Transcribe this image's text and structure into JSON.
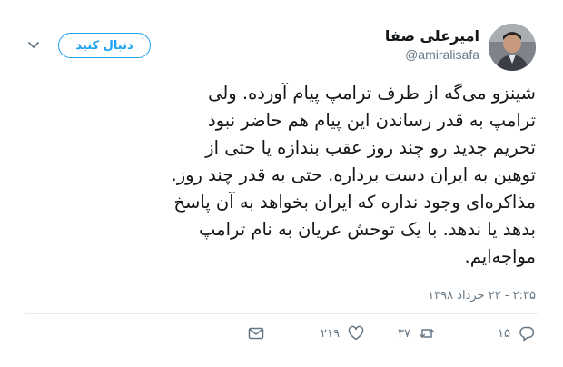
{
  "user": {
    "display_name": "امیرعلی صفا",
    "handle": "@amiralisafa"
  },
  "follow_button": {
    "label": "دنبال کنید"
  },
  "tweet": {
    "lines": [
      "شینزو می‌گه از طرف ترامپ پیام آورده. ولی",
      "ترامپ به قدر رساندن این پیام هم حاضر نبود",
      "تحریم جدید رو چند روز عقب بندازه یا حتی از",
      "توهین به ایران دست برداره. حتی به قدر چند روز.",
      "مذاکره‌ای وجود نداره که ایران بخواهد به آن پاسخ",
      "بدهد یا ندهد. با یک توحش عریان به نام ترامپ",
      "مواجه‌ایم."
    ],
    "timestamp": "۲:۳۵ - ۲۲ خرداد ۱۳۹۸"
  },
  "actions": {
    "reply_count": "۱۵",
    "retweet_count": "۳۷",
    "like_count": "۲۱۹"
  },
  "icons": {
    "reply": "reply-icon",
    "retweet": "retweet-icon",
    "like": "heart-icon",
    "dm": "envelope-icon",
    "menu": "chevron-down-icon"
  },
  "colors": {
    "accent": "#1da1f2",
    "text": "#14171a",
    "secondary": "#657786",
    "divider": "#e6ecf0"
  }
}
